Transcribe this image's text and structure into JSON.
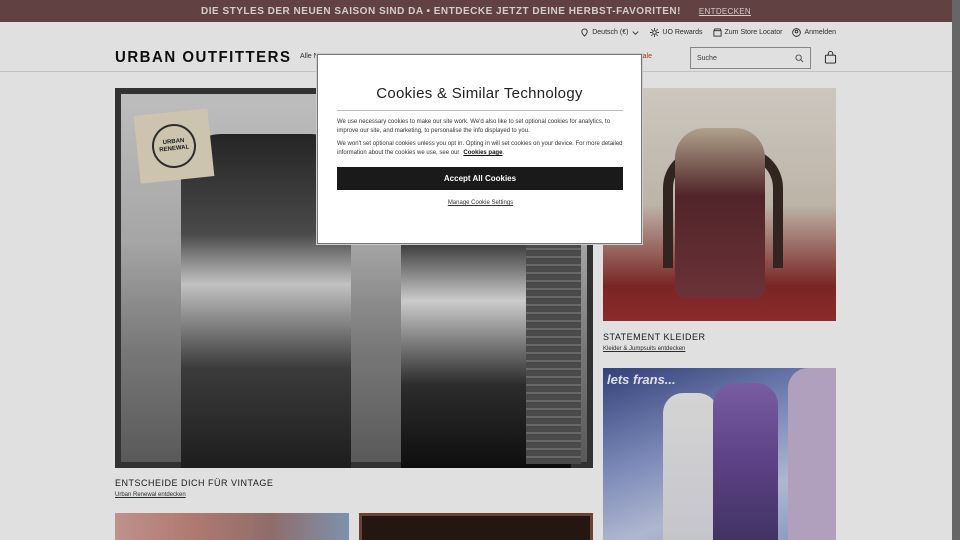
{
  "promo": {
    "text": "DIE STYLES DER NEUEN SAISON SIND DA • ENTDECKE JETZT DEINE HERBST-FAVORITEN!",
    "cta": "ENTDECKEN"
  },
  "utility": {
    "language": "Deutsch (€)",
    "rewards": "UO Rewards",
    "store": "Zum Store Locator",
    "login": "Anmelden"
  },
  "header": {
    "logo": "URBAN OUTFITTERS",
    "nav_partial": "Alle N",
    "sale_partial": "Sale",
    "search_placeholder": "Suche"
  },
  "tiles": [
    {
      "caption": "ENTSCHEIDE DICH FÜR VINTAGE",
      "link": "Urban Renewal entdecken",
      "badge": "URBAN RENEWAL"
    },
    {
      "caption": "STATEMENT KLEIDER",
      "link": "Kleider & Jumpsuits entdecken"
    },
    {
      "overlay_text": "lets frans..."
    }
  ],
  "modal": {
    "title": "Cookies & Similar Technology",
    "p1": "We use necessary cookies to make our site work. We'd also like to set optional cookies for analytics, to improve our site, and marketing, to personalise the info displayed to you.",
    "p2": "We won't set optional cookies unless you opt in. Opting in will set cookies on your device. For more detailed information about the cookies we use, see our",
    "p2_link": "Cookies page",
    "accept": "Accept All Cookies",
    "manage": "Manage Cookie Settings"
  },
  "colors": {
    "promo_bg": "#6f4a4a",
    "sale": "#c0392b",
    "accept_bg": "#1a1a1a"
  }
}
